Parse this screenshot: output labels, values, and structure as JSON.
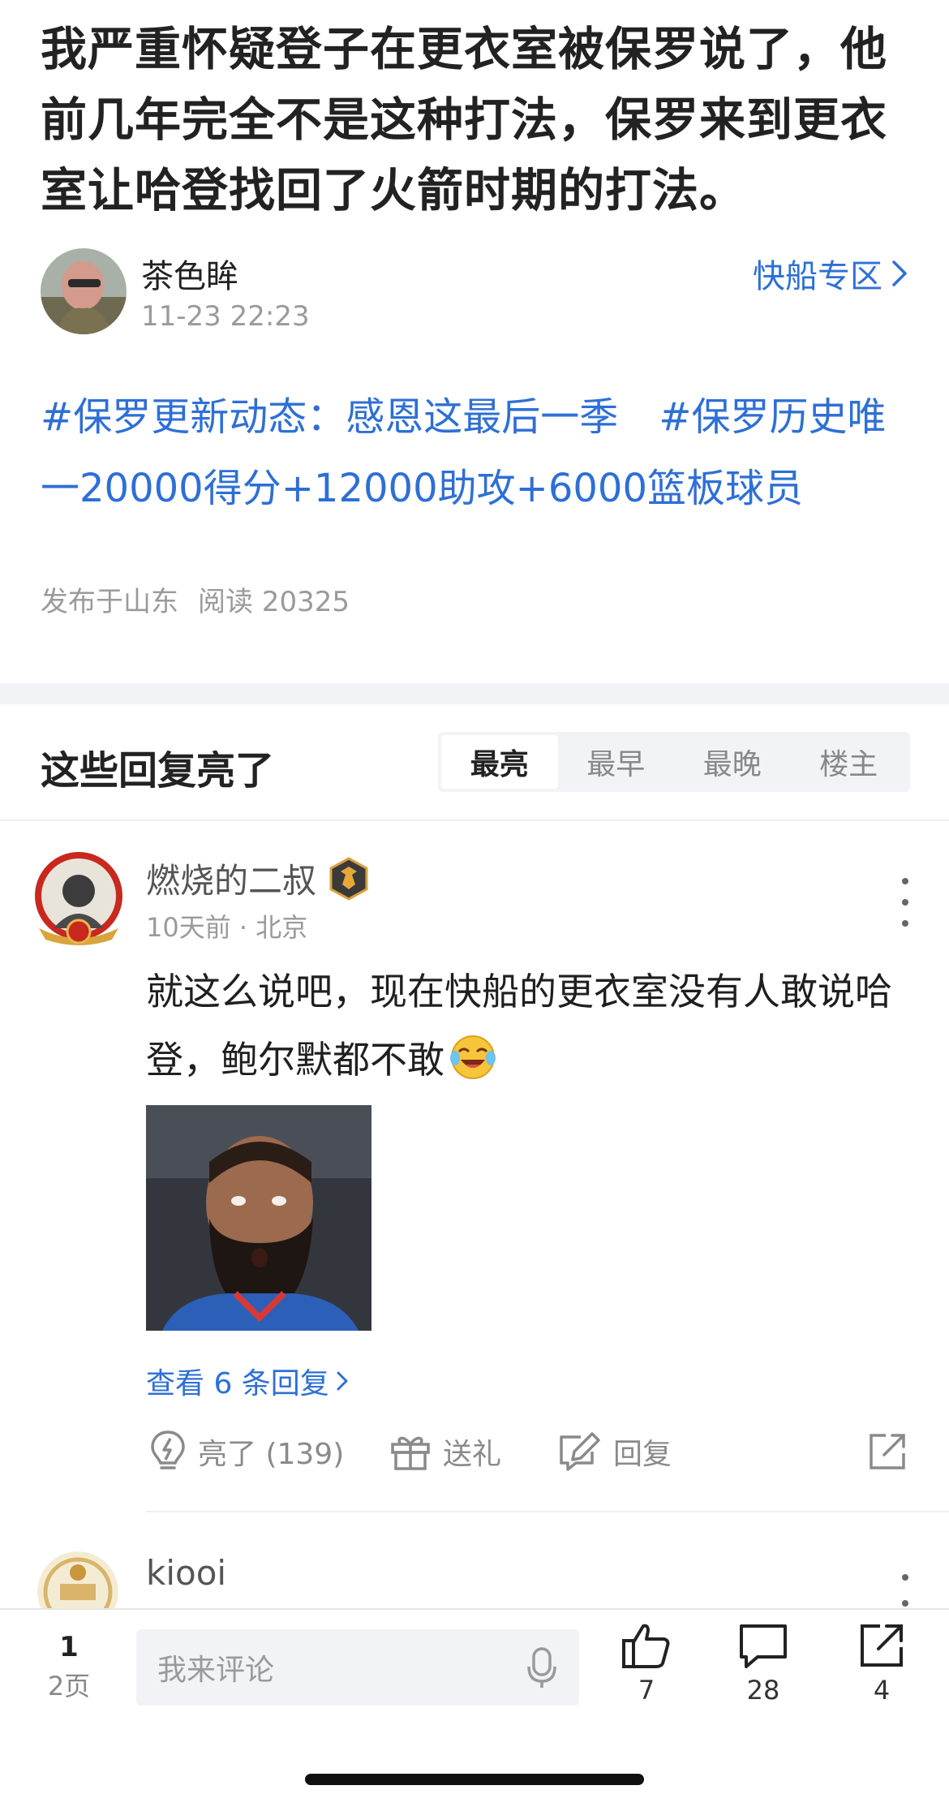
{
  "post": {
    "title": "我严重怀疑登子在更衣室被保罗说了，他前几年完全不是这种打法，保罗来到更衣室让哈登找回了火箭时期的打法。",
    "author": "茶色眸",
    "time": "11-23 22:23",
    "board": "快船专区",
    "tags": [
      "#保罗更新动态：感恩这最后一季",
      "#保罗历史唯一20000得分+12000助攻+6000篮板球员"
    ],
    "location": "发布于山东",
    "reads": "阅读 20325"
  },
  "replies": {
    "heading": "这些回复亮了",
    "sort_tabs": [
      "最亮",
      "最早",
      "最晚",
      "楼主"
    ],
    "active_tab": 0
  },
  "comment1": {
    "name": "燃烧的二叔",
    "meta": "10天前 · 北京",
    "text": "就这么说吧，现在快船的更衣室没有人敢说哈登，鲍尔默都不敢",
    "view_replies": "查看 6 条回复",
    "like": "亮了 (139)",
    "gift": "送礼",
    "reply": "回复"
  },
  "comment2": {
    "name": "kiooi"
  },
  "bottom": {
    "page_current": "1",
    "page_total": "2页",
    "input_placeholder": "我来评论",
    "likes": "7",
    "comments": "28",
    "shares": "4"
  },
  "colors": {
    "link": "#2e6fd6",
    "muted": "#9a9a9a",
    "band": "#f1f3f6"
  }
}
